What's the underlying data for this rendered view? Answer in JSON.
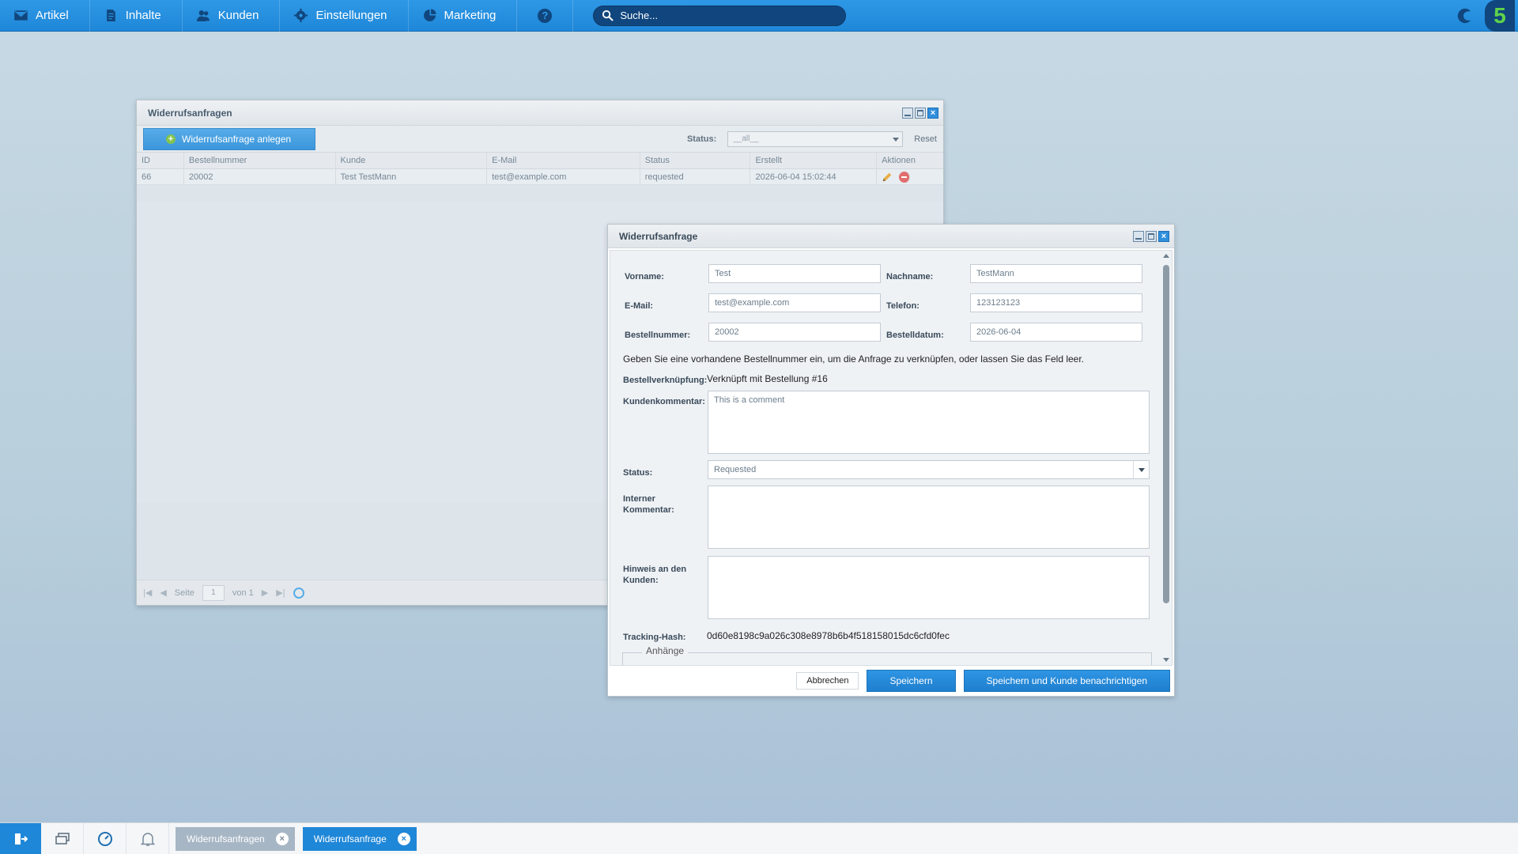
{
  "topbar": {
    "menu": [
      {
        "label": "Artikel",
        "icon": "envelope-icon"
      },
      {
        "label": "Inhalte",
        "icon": "document-icon"
      },
      {
        "label": "Kunden",
        "icon": "users-icon"
      },
      {
        "label": "Einstellungen",
        "icon": "gear-icon"
      },
      {
        "label": "Marketing",
        "icon": "pie-chart-icon"
      }
    ],
    "help_icon": "question-icon",
    "search_placeholder": "Suche...",
    "brand_icon": "shopware-icon",
    "version_badge": "5"
  },
  "list_window": {
    "title": "Widerrufsanfragen",
    "add_button": "Widerrufsanfrage anlegen",
    "status_label": "Status:",
    "status_filter_value": "__all__",
    "reset_label": "Reset",
    "columns": [
      "ID",
      "Bestellnummer",
      "Kunde",
      "E-Mail",
      "Status",
      "Erstellt",
      "Aktionen"
    ],
    "rows": [
      {
        "id": "66",
        "order": "20002",
        "customer": "Test TestMann",
        "email": "test@example.com",
        "status": "requested",
        "created": "2026-06-04 15:02:44"
      }
    ],
    "pager": {
      "page_label": "Seite",
      "page_value": "1",
      "of_label": "von 1"
    }
  },
  "dialog": {
    "title": "Widerrufsanfrage",
    "fields": {
      "firstname_label": "Vorname:",
      "firstname_value": "Test",
      "lastname_label": "Nachname:",
      "lastname_value": "TestMann",
      "email_label": "E-Mail:",
      "email_value": "test@example.com",
      "phone_label": "Telefon:",
      "phone_value": "123123123",
      "ordernumber_label": "Bestellnummer:",
      "ordernumber_value": "20002",
      "orderdate_label": "Bestelldatum:",
      "orderdate_value": "2026-06-04",
      "hint_text": "Geben Sie eine vorhandene Bestellnummer ein, um die Anfrage zu verknüpfen, oder lassen Sie das Feld leer.",
      "link_label": "Bestellverknüpfung:",
      "link_value": "Verknüpft mit Bestellung #16",
      "comment_label": "Kundenkommentar:",
      "comment_value": "This is a comment",
      "status_label": "Status:",
      "status_value": "Requested",
      "internal_label": "Interner Kommentar:",
      "internal_value": "",
      "customer_note_label": "Hinweis an den Kunden:",
      "customer_note_value": "",
      "tracking_label": "Tracking-Hash:",
      "tracking_value": "0d60e8198c9a026c308e8978b6b4f518158015dc6cfd0fec",
      "attachments_legend": "Anhänge"
    },
    "buttons": {
      "cancel": "Abbrechen",
      "save": "Speichern",
      "save_notify": "Speichern und Kunde benachrichtigen"
    }
  },
  "taskbar": {
    "tasks": [
      {
        "label": "Widerrufsanfragen",
        "active": false
      },
      {
        "label": "Widerrufsanfrage",
        "active": true
      }
    ]
  },
  "colors": {
    "accent": "#1f87d8",
    "topbar": "#2e98e6",
    "dark_icon": "#10467d",
    "brand_green": "#5fd34b",
    "delete_red": "#e06363"
  }
}
